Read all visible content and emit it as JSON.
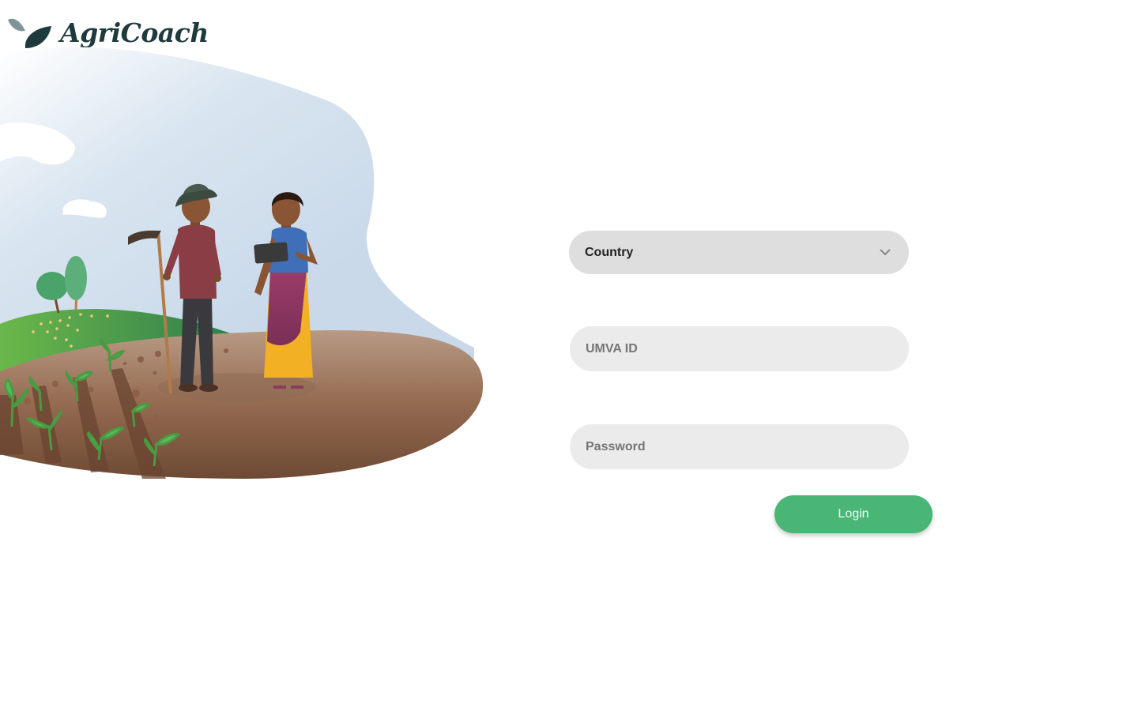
{
  "brand": {
    "name": "AgriCoach"
  },
  "form": {
    "country": {
      "label": "Country",
      "icon": "chevron-down-icon"
    },
    "umva_id": {
      "placeholder": "UMVA ID",
      "value": ""
    },
    "password": {
      "placeholder": "Password",
      "value": ""
    },
    "login_label": "Login"
  },
  "colors": {
    "primary": "#49b676",
    "field_bg": "#ebebeb",
    "select_bg": "#dedede",
    "logo_dark": "#1f3a3d"
  }
}
